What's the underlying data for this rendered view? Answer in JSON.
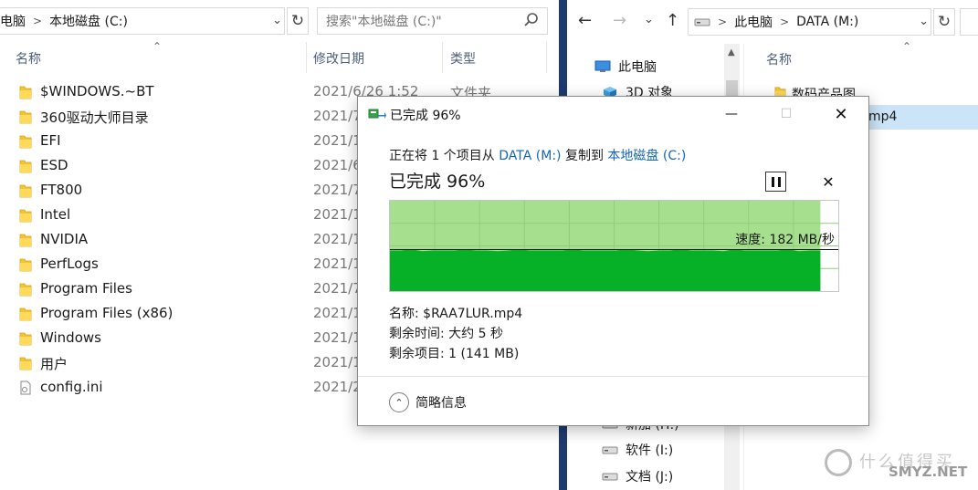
{
  "left_explorer": {
    "address_crumbs": [
      "电脑",
      "本地磁盘 (C:)"
    ],
    "search_placeholder": "搜索\"本地磁盘 (C:)\"",
    "columns": [
      "名称",
      "修改日期",
      "类型"
    ],
    "files": [
      {
        "name": "$WINDOWS.~BT",
        "date": "2021/6/26 1:52",
        "type": "文件夹",
        "kind": "folder"
      },
      {
        "name": "360驱动大师目录",
        "date": "2021/7",
        "type": "",
        "kind": "folder"
      },
      {
        "name": "EFI",
        "date": "2021/1",
        "type": "",
        "kind": "folder"
      },
      {
        "name": "ESD",
        "date": "2021/6",
        "type": "",
        "kind": "folder"
      },
      {
        "name": "FT800",
        "date": "2021/7",
        "type": "",
        "kind": "folder"
      },
      {
        "name": "Intel",
        "date": "2021/1",
        "type": "",
        "kind": "folder"
      },
      {
        "name": "NVIDIA",
        "date": "2021/1",
        "type": "",
        "kind": "folder"
      },
      {
        "name": "PerfLogs",
        "date": "2021/1",
        "type": "",
        "kind": "folder"
      },
      {
        "name": "Program Files",
        "date": "2021/7",
        "type": "",
        "kind": "folder"
      },
      {
        "name": "Program Files (x86)",
        "date": "2021/1",
        "type": "",
        "kind": "folder"
      },
      {
        "name": "Windows",
        "date": "2021/1",
        "type": "",
        "kind": "folder"
      },
      {
        "name": "用户",
        "date": "2021/1",
        "type": "",
        "kind": "folder"
      },
      {
        "name": "config.ini",
        "date": "2021/2",
        "type": "",
        "kind": "file"
      }
    ]
  },
  "right_explorer": {
    "address_crumbs": [
      "此电脑",
      "DATA (M:)"
    ],
    "nav_tree": [
      {
        "label": "此电脑",
        "icon": "computer-icon"
      },
      {
        "label": "3D 对象",
        "icon": "3d-objects-icon"
      },
      {
        "label": "新加 (H:)",
        "icon": "drive-icon"
      },
      {
        "label": "软件 (I:)",
        "icon": "drive-icon"
      },
      {
        "label": "文档 (J:)",
        "icon": "drive-icon"
      }
    ],
    "column": "名称",
    "files": [
      {
        "name": "数码产品图",
        "kind": "folder"
      },
      {
        "name": "mp4",
        "kind": "video"
      }
    ]
  },
  "copy_dialog": {
    "title": "已完成 96%",
    "desc_prefix": "正在将 1 个项目从 ",
    "source": "DATA (M:)",
    "desc_middle": " 复制到 ",
    "destination": "本地磁盘 (C:)",
    "heading": "已完成 96%",
    "progress_fraction": 0.96,
    "speed_label": "速度: 182 MB/秒",
    "speed_level": 0.46,
    "name_line": "名称: $RAA7LUR.mp4",
    "time_line": "剩余时间: 大约 5 秒",
    "items_line": "剩余项目: 1 (141 MB)",
    "details_toggle": "简略信息",
    "colors": {
      "progress_bg": "#a6e08f",
      "speed_fill": "#06b027",
      "link": "#1466b8"
    }
  },
  "watermark": {
    "text": "什么值得买",
    "site": "SMYZ.NET"
  }
}
